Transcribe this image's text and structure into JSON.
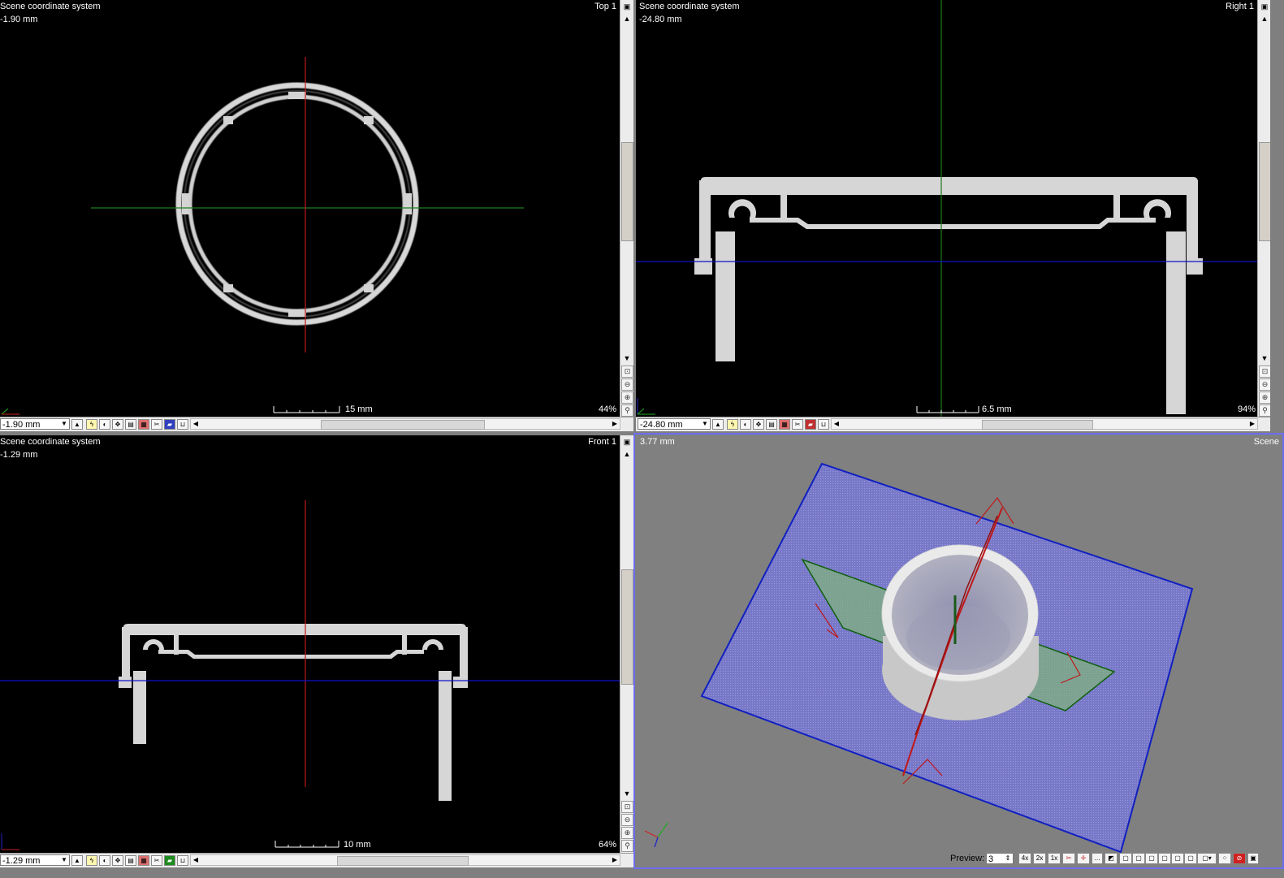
{
  "views": {
    "top": {
      "header": "Scene coordinate system",
      "depth": "-1.90 mm",
      "name": "Top 1",
      "scale_text": "15 mm",
      "zoom": "44%",
      "combo_value": "-1.90 mm"
    },
    "right": {
      "header": "Scene coordinate system",
      "depth": "-24.80 mm",
      "name": "Right 1",
      "scale_text": "6.5 mm",
      "zoom": "94%",
      "combo_value": "-24.80 mm"
    },
    "front": {
      "header": "Scene coordinate system",
      "depth": "-1.29 mm",
      "name": "Front 1",
      "scale_text": "10 mm",
      "zoom": "64%",
      "combo_value": "-1.29 mm"
    },
    "scene": {
      "distance": "3.77 mm",
      "name": "Scene",
      "preview_label": "Preview:",
      "preview_value": "3",
      "zoom_buttons": [
        "4x",
        "2x",
        "1x"
      ]
    }
  },
  "icons": {
    "maximize": "maximize-icon",
    "scroll_up": "arrow-up-icon",
    "scroll_down": "arrow-down-icon",
    "zoom_fit": "zoom-fit-icon",
    "zoom_in": "zoom-in-icon",
    "zoom_out": "zoom-out-icon"
  },
  "colors": {
    "red_axis": "#c01818",
    "green_axis": "#1c7c1c",
    "blue_axis": "#1010c8",
    "scene_background": "#808080",
    "scene_frame": "#6d6df0"
  }
}
